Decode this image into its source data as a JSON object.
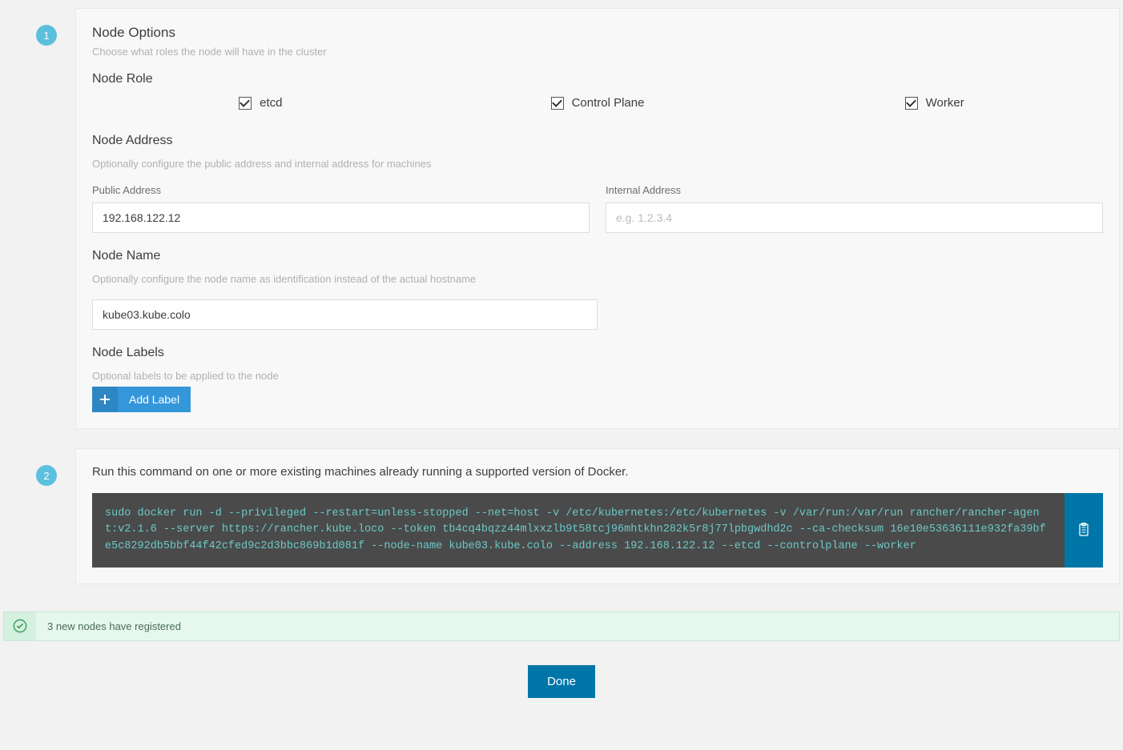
{
  "step1": {
    "number": "1",
    "title": "Node Options",
    "subtitle": "Choose what roles the node will have in the cluster",
    "role_section": "Node Role",
    "roles": {
      "etcd": "etcd",
      "controlplane": "Control Plane",
      "worker": "Worker"
    },
    "address_section": "Node Address",
    "address_subtitle": "Optionally configure the public address and internal address for machines",
    "public_label": "Public Address",
    "public_value": "192.168.122.12",
    "internal_label": "Internal Address",
    "internal_placeholder": "e.g. 1.2.3.4",
    "name_section": "Node Name",
    "name_subtitle": "Optionally configure the node name as identification instead of the actual hostname",
    "name_value": "kube03.kube.colo",
    "labels_section": "Node Labels",
    "labels_subtitle": "Optional labels to be applied to the node",
    "add_label_btn": "Add Label"
  },
  "step2": {
    "number": "2",
    "instruction": "Run this command on one or more existing machines already running a supported version of Docker.",
    "command": "sudo docker run -d --privileged --restart=unless-stopped --net=host -v /etc/kubernetes:/etc/kubernetes -v /var/run:/var/run rancher/rancher-agent:v2.1.6 --server https://rancher.kube.loco --token tb4cq4bqzz44mlxxzlb9t58tcj96mhtkhn282k5r8j77lpbgwdhd2c --ca-checksum 16e10e53636111e932fa39bfe5c8292db5bbf44f42cfed9c2d3bbc869b1d081f --node-name kube03.kube.colo --address 192.168.122.12 --etcd --controlplane --worker"
  },
  "status": {
    "message": "3 new nodes have registered"
  },
  "footer": {
    "done": "Done"
  }
}
